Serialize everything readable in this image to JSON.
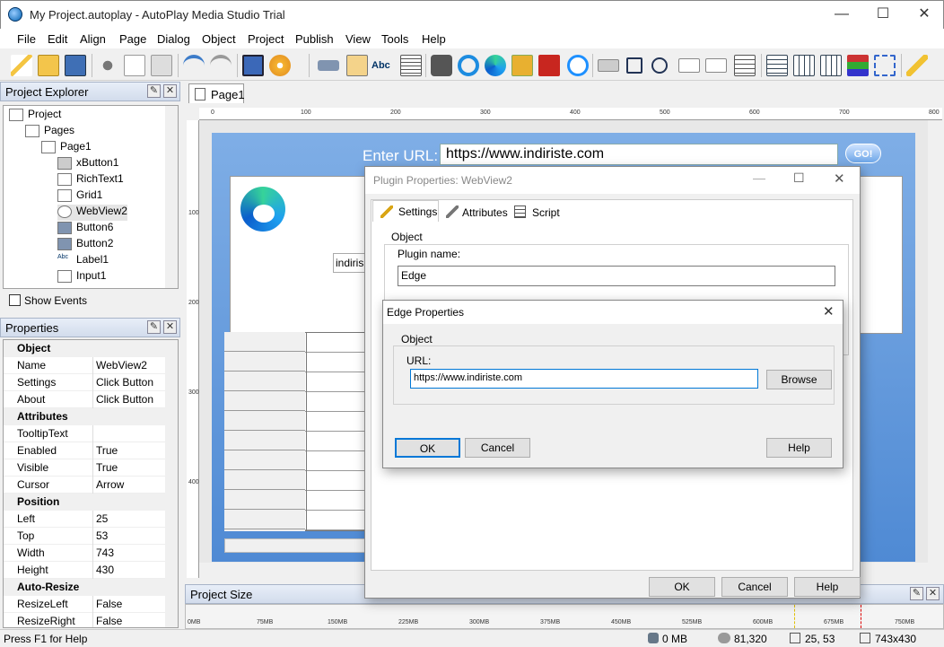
{
  "window": {
    "title": "My Project.autoplay - AutoPlay Media Studio Trial",
    "minimize": "—",
    "maximize": "☐",
    "close": "✕"
  },
  "menu": [
    "File",
    "Edit",
    "Align",
    "Page",
    "Dialog",
    "Object",
    "Project",
    "Publish",
    "View",
    "Tools",
    "Help"
  ],
  "explorer": {
    "title": "Project Explorer",
    "items": [
      {
        "label": "Project",
        "level": 0
      },
      {
        "label": "Pages",
        "level": 1
      },
      {
        "label": "Page1",
        "level": 2
      },
      {
        "label": "xButton1",
        "level": 3
      },
      {
        "label": "RichText1",
        "level": 3
      },
      {
        "label": "Grid1",
        "level": 3
      },
      {
        "label": "WebView2",
        "level": 3
      },
      {
        "label": "Button6",
        "level": 3
      },
      {
        "label": "Button2",
        "level": 3
      },
      {
        "label": "Label1",
        "level": 3
      },
      {
        "label": "Input1",
        "level": 3
      }
    ],
    "show_events": "Show Events"
  },
  "properties": {
    "title": "Properties",
    "rows": [
      {
        "cat": "Object"
      },
      {
        "k": "Name",
        "v": "WebView2"
      },
      {
        "k": "Settings",
        "v": "Click Button"
      },
      {
        "k": "About",
        "v": "Click Button"
      },
      {
        "cat": "Attributes"
      },
      {
        "k": "TooltipText",
        "v": ""
      },
      {
        "k": "Enabled",
        "v": "True"
      },
      {
        "k": "Visible",
        "v": "True"
      },
      {
        "k": "Cursor",
        "v": "Arrow"
      },
      {
        "cat": "Position"
      },
      {
        "k": "Left",
        "v": "25"
      },
      {
        "k": "Top",
        "v": "53"
      },
      {
        "k": "Width",
        "v": "743"
      },
      {
        "k": "Height",
        "v": "430"
      },
      {
        "cat": "Auto-Resize"
      },
      {
        "k": "ResizeLeft",
        "v": "False"
      },
      {
        "k": "ResizeRight",
        "v": "False"
      }
    ]
  },
  "tab": {
    "label": "Page1"
  },
  "ruler_top": [
    "0",
    "100",
    "200",
    "300",
    "400",
    "500",
    "600",
    "700",
    "800"
  ],
  "ruler_left": [
    "100",
    "200",
    "300",
    "400"
  ],
  "page": {
    "enter_url": "Enter URL:",
    "url_value": "https://www.indiriste.com",
    "go": "GO!",
    "indiris": "indiris"
  },
  "project_size": {
    "title": "Project Size",
    "ticks": [
      "0MB",
      "75MB",
      "150MB",
      "225MB",
      "300MB",
      "375MB",
      "450MB",
      "525MB",
      "600MB",
      "675MB",
      "750MB"
    ]
  },
  "status": {
    "help": "Press F1 for Help",
    "mem": "0 MB",
    "coords": "81,320",
    "pos": "25, 53",
    "size": "743x430"
  },
  "plugin_dialog": {
    "title": "Plugin Properties: WebView2",
    "tabs": [
      "Settings",
      "Attributes",
      "Script"
    ],
    "object_group": "Object",
    "plugin_name_label": "Plugin name:",
    "plugin_name": "Edge",
    "ok": "OK",
    "cancel": "Cancel",
    "help": "Help"
  },
  "edge_dialog": {
    "title": "Edge Properties",
    "object_group": "Object",
    "url_label": "URL:",
    "url": "https://www.indiriste.com",
    "browse": "Browse",
    "ok": "OK",
    "cancel": "Cancel",
    "help": "Help"
  },
  "colors": {
    "page_top": "#7faee6",
    "page_bottom": "#4f8ad4",
    "focus": "#0078d7"
  }
}
